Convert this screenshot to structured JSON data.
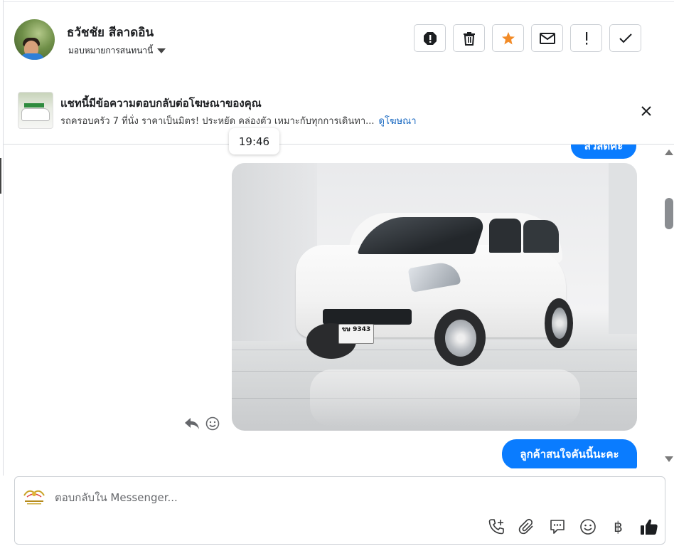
{
  "header": {
    "contact_name": "ธวัชชัย สีลาดอิน",
    "assign_label": "มอบหมายการสนทนานี้"
  },
  "actions": [
    {
      "name": "spam-icon"
    },
    {
      "name": "trash-icon"
    },
    {
      "name": "star-icon",
      "color": "#f28b27"
    },
    {
      "name": "mail-icon"
    },
    {
      "name": "exclamation-icon",
      "glyph": "!"
    },
    {
      "name": "check-icon"
    }
  ],
  "ad": {
    "title": "แชทนี้มีข้อความตอบกลับต่อโฆษณาของคุณ",
    "subtitle": "รถครอบครัว 7 ที่นั่ง ราคาเป็นมิตร! ประหยัด คล่องตัว เหมาะกับทุกการเดินทา...",
    "link": "ดูโฆษณา"
  },
  "messages": {
    "top_bubble": "สวัสดีค่ะ",
    "bottom_bubble": "ลูกค้าสนใจคันนี้นะคะ",
    "plate_text": "ขษ 9343"
  },
  "tooltip": {
    "time": "19:46"
  },
  "composer": {
    "placeholder": "ตอบกลับใน Messenger..."
  },
  "tools": [
    "call-add-icon",
    "attachment-icon",
    "saved-reply-icon",
    "emoji-icon",
    "baht-icon",
    "like-icon"
  ],
  "colors": {
    "brand_blue": "#0a7cff",
    "link_blue": "#1566c0",
    "star_orange": "#f28b27"
  }
}
